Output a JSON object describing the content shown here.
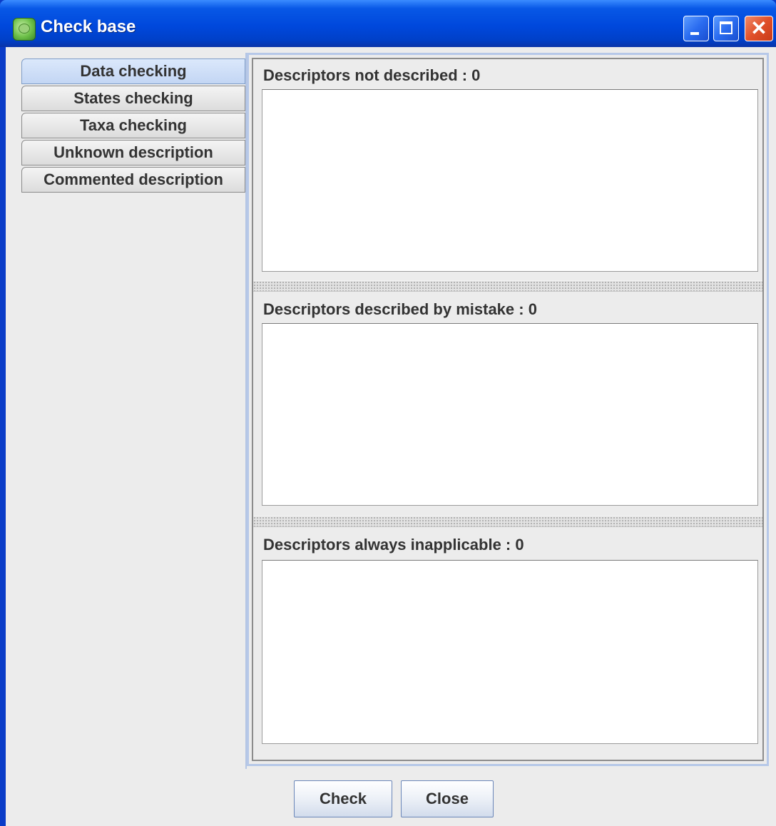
{
  "window": {
    "title": "Check base",
    "controls": {
      "minimize": "minimize-icon",
      "maximize": "maximize-icon",
      "close": "close-icon"
    }
  },
  "tabs": [
    {
      "label": "Data checking",
      "selected": true
    },
    {
      "label": "States checking",
      "selected": false
    },
    {
      "label": "Taxa checking",
      "selected": false
    },
    {
      "label": "Unknown description",
      "selected": false
    },
    {
      "label": "Commented description",
      "selected": false
    }
  ],
  "sections": [
    {
      "label": "Descriptors not described : 0"
    },
    {
      "label": "Descriptors described by mistake : 0"
    },
    {
      "label": "Descriptors always inapplicable : 0"
    }
  ],
  "buttons": {
    "check": "Check",
    "close": "Close"
  },
  "colors": {
    "titlebar": "#0048dc",
    "selected_tab": "#c3d6f4",
    "background": "#ececec"
  }
}
